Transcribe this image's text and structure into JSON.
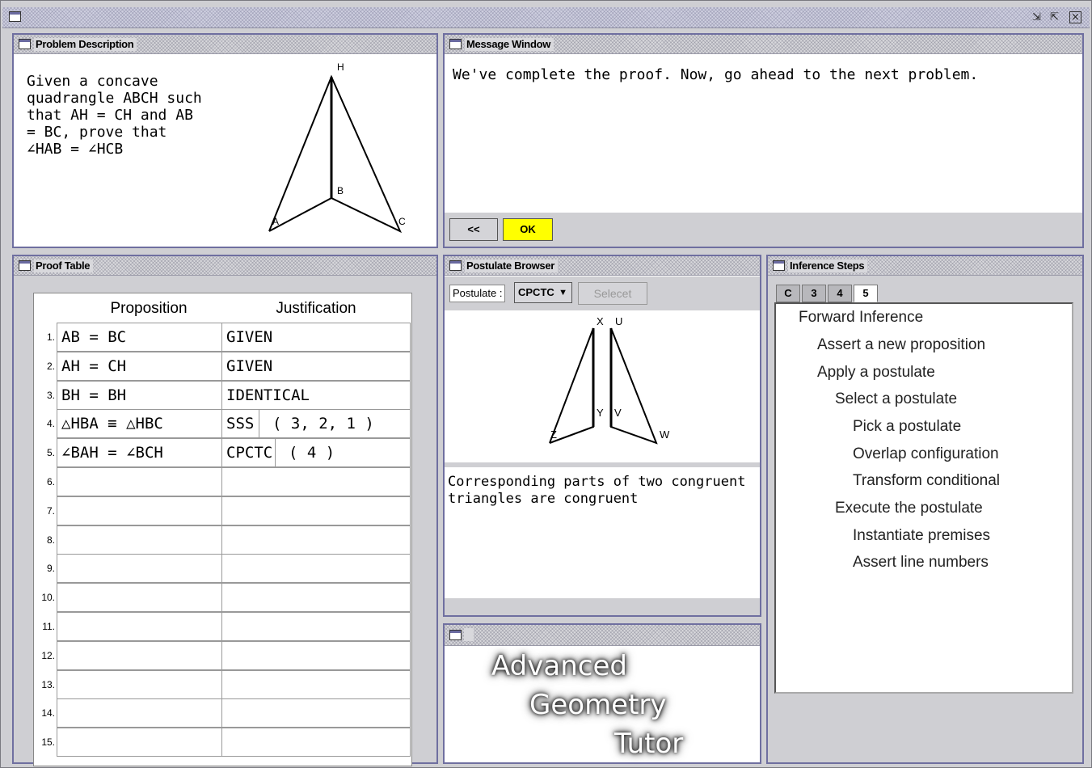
{
  "problem": {
    "title": "Problem Description",
    "text": "Given a concave\nquadrangle ABCH such\nthat AH = CH and AB\n= BC, prove that\n∠HAB = ∠HCB",
    "labels": {
      "h": "H",
      "b": "B",
      "a": "A",
      "c": "C"
    }
  },
  "message": {
    "title": "Message Window",
    "text": "We've complete the proof.  Now, go ahead to the next problem.",
    "back_label": "<<",
    "ok_label": "OK"
  },
  "proof": {
    "title": "Proof Table",
    "header_proposition": "Proposition",
    "header_justification": "Justification",
    "rows": [
      {
        "num": "1.",
        "prop": "AB = BC",
        "just": "GIVEN",
        "args": ""
      },
      {
        "num": "2.",
        "prop": "AH = CH",
        "just": "GIVEN",
        "args": ""
      },
      {
        "num": "3.",
        "prop": "BH = BH",
        "just": "IDENTICAL",
        "args": ""
      },
      {
        "num": "4.",
        "prop": "△HBA ≡ △HBC",
        "just": "SSS",
        "args": "( 3, 2, 1 )"
      },
      {
        "num": "5.",
        "prop": "∠BAH = ∠BCH",
        "just": "CPCTC",
        "args": "( 4 )"
      },
      {
        "num": "6.",
        "prop": "",
        "just": "",
        "args": ""
      },
      {
        "num": "7.",
        "prop": "",
        "just": "",
        "args": ""
      },
      {
        "num": "8.",
        "prop": "",
        "just": "",
        "args": ""
      },
      {
        "num": "9.",
        "prop": "",
        "just": "",
        "args": ""
      },
      {
        "num": "10.",
        "prop": "",
        "just": "",
        "args": ""
      },
      {
        "num": "11.",
        "prop": "",
        "just": "",
        "args": ""
      },
      {
        "num": "12.",
        "prop": "",
        "just": "",
        "args": ""
      },
      {
        "num": "13.",
        "prop": "",
        "just": "",
        "args": ""
      },
      {
        "num": "14.",
        "prop": "",
        "just": "",
        "args": ""
      },
      {
        "num": "15.",
        "prop": "",
        "just": "",
        "args": ""
      }
    ]
  },
  "postulate": {
    "title": "Postulate Browser",
    "label": "Postulate :",
    "selected": "CPCTC",
    "select_label": "Selecet",
    "description": "Corresponding parts of two congruent\ntriangles are congruent",
    "labels": {
      "x": "X",
      "u": "U",
      "y": "Y",
      "v": "V",
      "z": "Z",
      "w": "W"
    }
  },
  "logo": {
    "line1": "Advanced",
    "line2": "Geometry",
    "line3": "Tutor"
  },
  "inference": {
    "title": "Inference Steps",
    "tabs": [
      "C",
      "3",
      "4",
      "5"
    ],
    "active_tab": "5",
    "items": [
      "Forward Inference",
      "Assert a new proposition",
      "Apply a postulate",
      "Select a postulate",
      "Pick a postulate",
      "Overlap configuration",
      "Transform conditional",
      "Execute the postulate",
      "Instantiate premises",
      "Assert line numbers"
    ]
  },
  "colors": {
    "ok_button": "#ffff00",
    "panel_border": "#6f6fa0"
  }
}
